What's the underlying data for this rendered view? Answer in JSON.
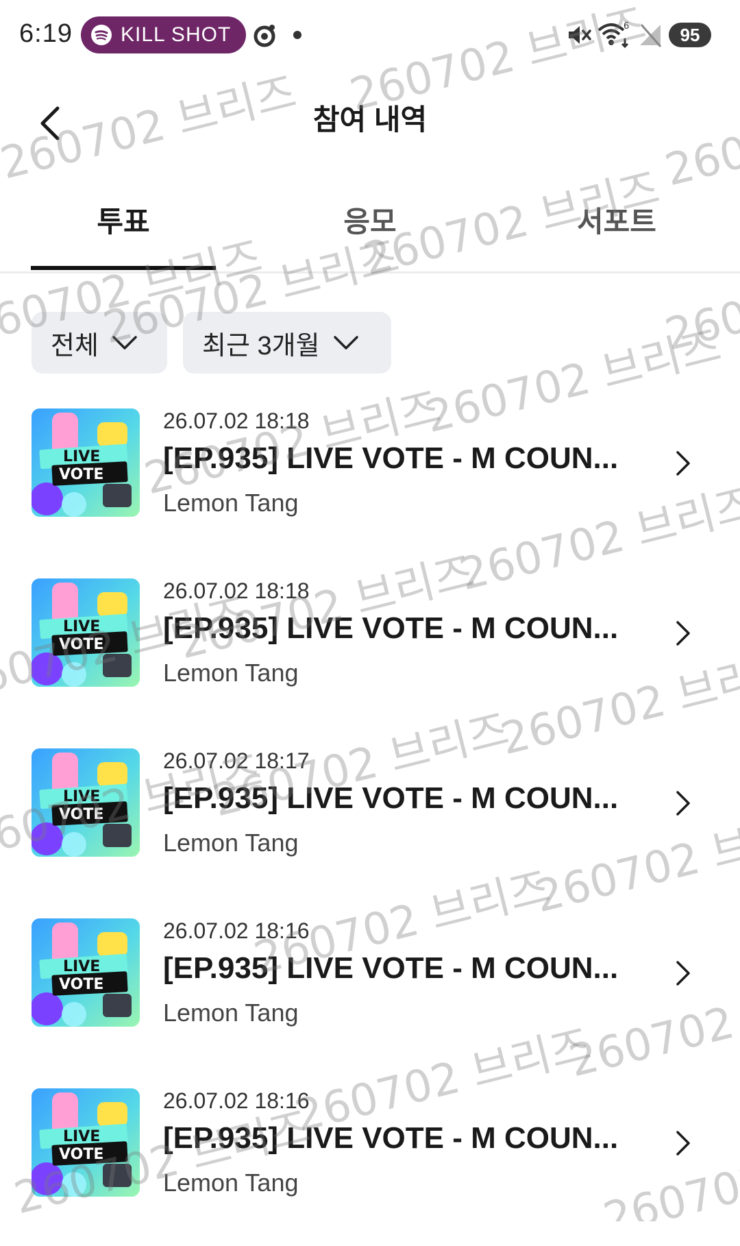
{
  "status_bar": {
    "time": "6:19",
    "media_label": "KILL SHOT",
    "wifi_badge": "6",
    "battery": "95"
  },
  "header": {
    "title": "참여 내역"
  },
  "tabs": [
    {
      "label": "투표",
      "active": true
    },
    {
      "label": "응모",
      "active": false
    },
    {
      "label": "서포트",
      "active": false
    }
  ],
  "filters": {
    "category": "전체",
    "period": "최근 3개월"
  },
  "items": [
    {
      "time": "26.07.02 18:18",
      "title": "[EP.935] LIVE VOTE - M COUN...",
      "subtitle": "Lemon Tang",
      "thumb_text_1": "LIVE",
      "thumb_text_2": "VOTE"
    },
    {
      "time": "26.07.02 18:18",
      "title": "[EP.935] LIVE VOTE - M COUN...",
      "subtitle": "Lemon Tang",
      "thumb_text_1": "LIVE",
      "thumb_text_2": "VOTE"
    },
    {
      "time": "26.07.02 18:17",
      "title": "[EP.935] LIVE VOTE - M COUN...",
      "subtitle": "Lemon Tang",
      "thumb_text_1": "LIVE",
      "thumb_text_2": "VOTE"
    },
    {
      "time": "26.07.02 18:16",
      "title": "[EP.935] LIVE VOTE - M COUN...",
      "subtitle": "Lemon Tang",
      "thumb_text_1": "LIVE",
      "thumb_text_2": "VOTE"
    },
    {
      "time": "26.07.02 18:16",
      "title": "[EP.935] LIVE VOTE - M COUN...",
      "subtitle": "Lemon Tang",
      "thumb_text_1": "LIVE",
      "thumb_text_2": "VOTE"
    }
  ],
  "watermark_text": "260702 브리즈"
}
